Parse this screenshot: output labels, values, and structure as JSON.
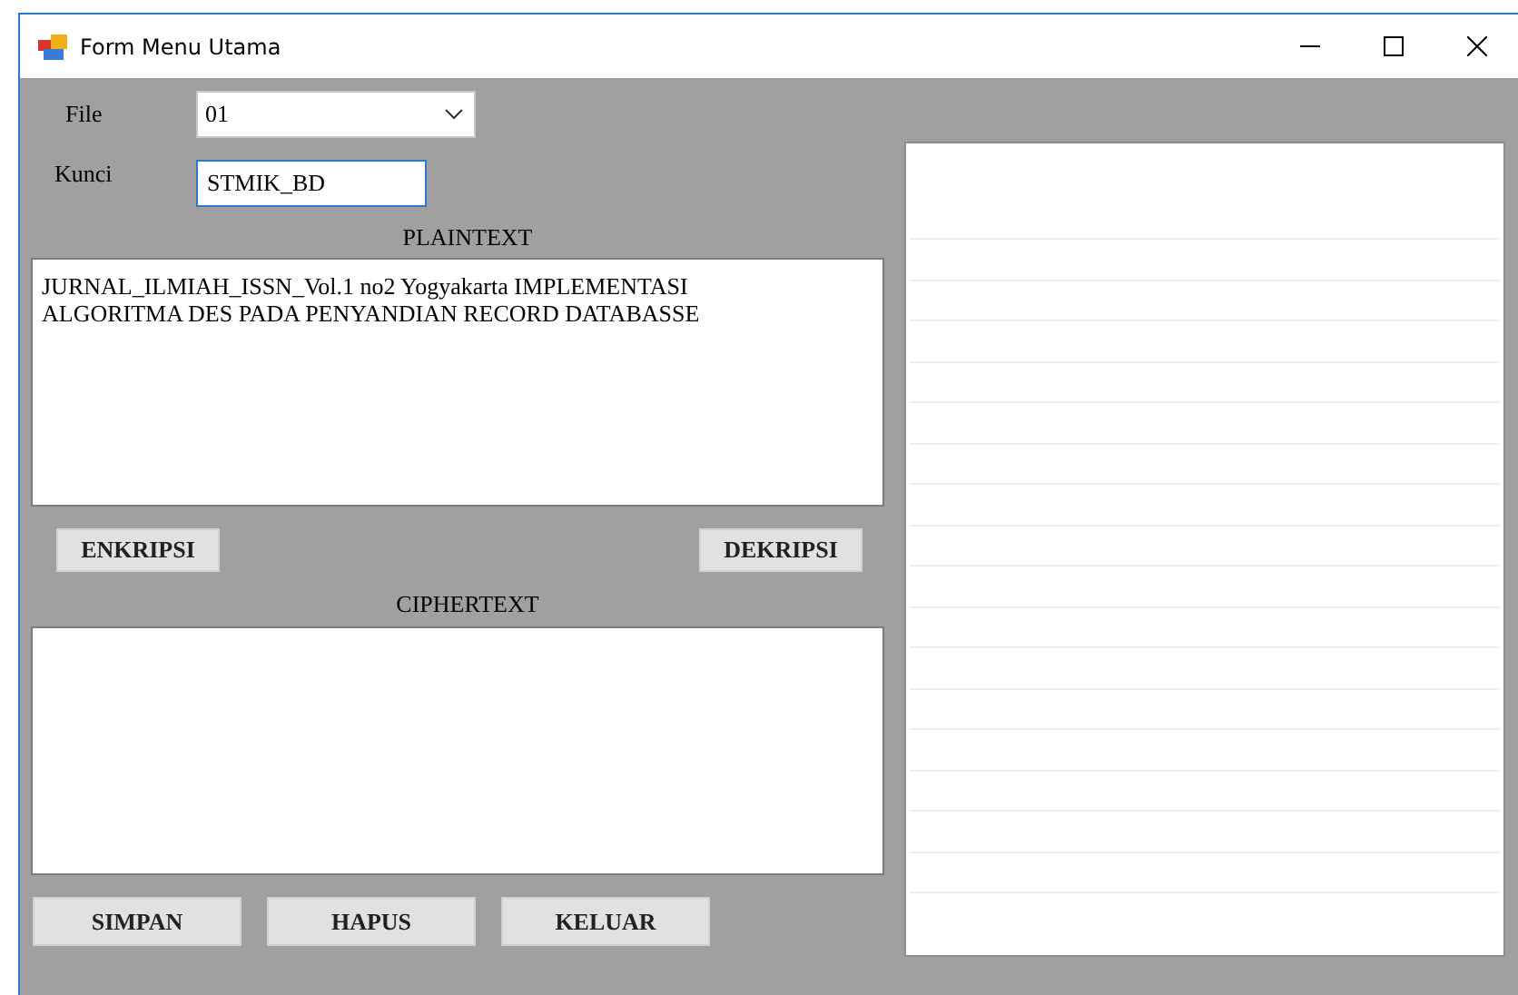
{
  "window": {
    "title": "Form Menu Utama"
  },
  "file": {
    "label": "File",
    "value": "01"
  },
  "key": {
    "label": "Kunci",
    "value": "STMIK_BD"
  },
  "plaintext": {
    "label": "PLAINTEXT",
    "value": "JURNAL_ILMIAH_ISSN_Vol.1 no2 Yogyakarta IMPLEMENTASI ALGORITMA DES PADA PENYANDIAN RECORD DATABASSE"
  },
  "crypt_buttons": [
    "ENKRIPSI",
    "DEKRIPSI"
  ],
  "ciphertext": {
    "label": "CIPHERTEXT"
  },
  "bottom_buttons": [
    "SIMPAN",
    "HAPUS",
    "KELUAR"
  ]
}
